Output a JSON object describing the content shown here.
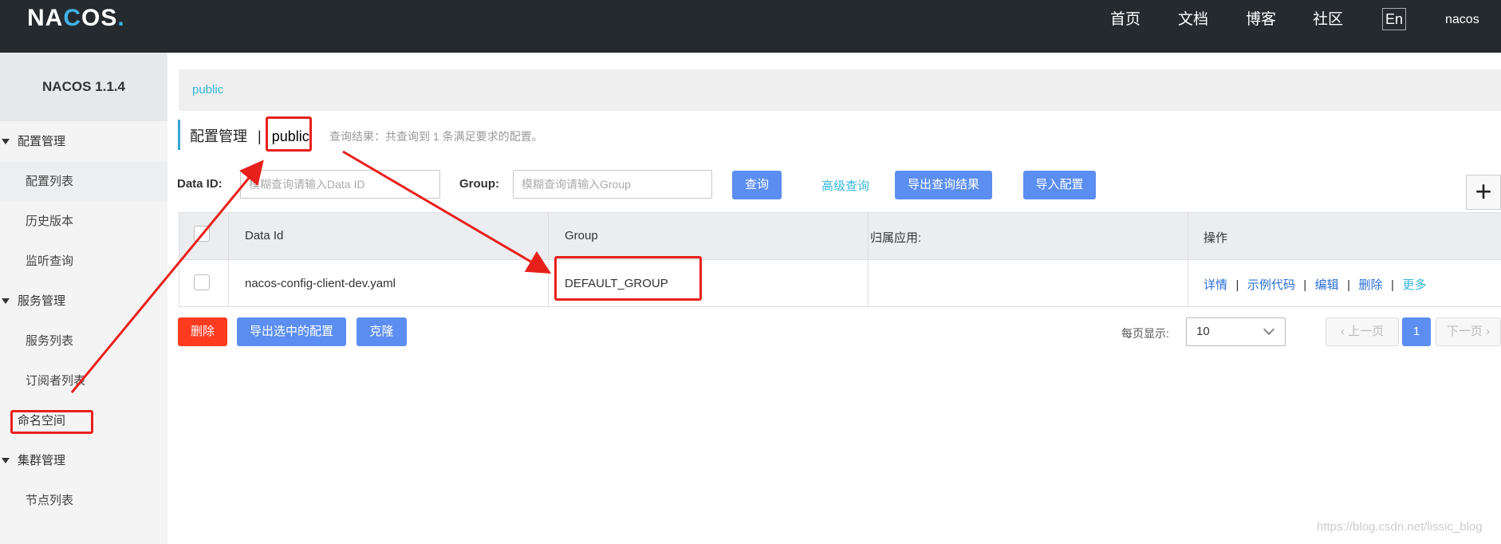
{
  "topbar": {
    "logo": "NACOS.",
    "nav": [
      "首页",
      "文档",
      "博客",
      "社区"
    ],
    "lang": "En",
    "user": "nacos"
  },
  "sidebar": {
    "version": "NACOS 1.1.4",
    "groups": [
      {
        "label": "配置管理",
        "items": [
          "配置列表",
          "历史版本",
          "监听查询"
        ]
      },
      {
        "label": "服务管理",
        "items": [
          "服务列表",
          "订阅者列表"
        ]
      },
      {
        "label": "集群管理",
        "items": [
          "节点列表"
        ]
      }
    ],
    "namespace": "命名空间"
  },
  "breadcrumb": "public",
  "title": {
    "section": "配置管理",
    "divider": "|",
    "namespace": "public",
    "result": "查询结果：共查询到 1 条满足要求的配置。"
  },
  "search": {
    "data_id_label": "Data ID:",
    "data_id_placeholder": "模糊查询请输入Data ID",
    "group_label": "Group:",
    "group_placeholder": "模糊查询请输入Group",
    "query_button": "查询",
    "advanced_link": "高级查询",
    "export_button": "导出查询结果",
    "import_button": "导入配置"
  },
  "table": {
    "columns": [
      "Data Id",
      "Group",
      "归属应用:",
      "操作"
    ],
    "rows": [
      {
        "data_id": "nacos-config-client-dev.yaml",
        "group": "DEFAULT_GROUP",
        "app": ""
      }
    ],
    "actions": [
      "详情",
      "示例代码",
      "编辑",
      "删除",
      "更多"
    ],
    "action_sep": "|"
  },
  "bulk": {
    "delete": "删除",
    "export_selected": "导出选中的配置",
    "clone": "克隆"
  },
  "pagination": {
    "page_size_label": "每页显示:",
    "page_size": "10",
    "prev": "上一页",
    "current": "1",
    "next": "下一页"
  },
  "watermark": "https://blog.csdn.net/lissic_blog",
  "colors": {
    "primary": "#5b8ef0",
    "danger": "#ff3b1f",
    "link": "#34b6d8",
    "annotation": "#e8201c"
  }
}
